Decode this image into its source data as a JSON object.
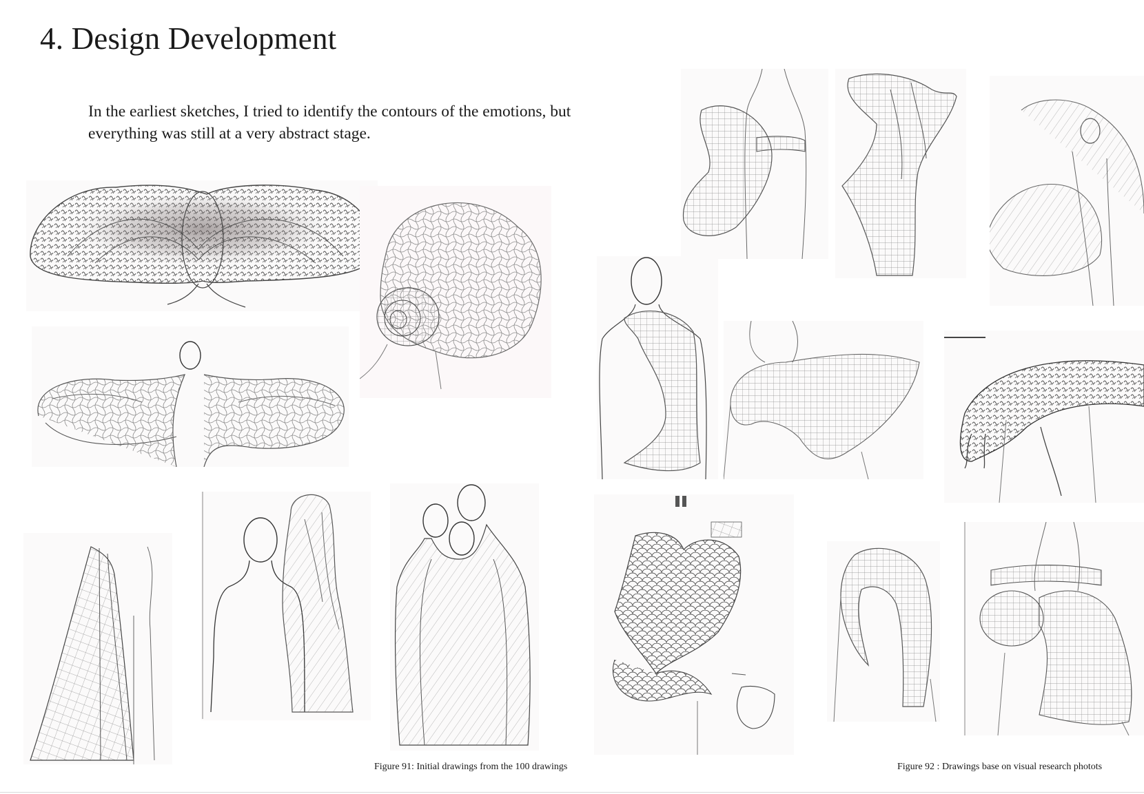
{
  "page": {
    "title": "4. Design Development",
    "intro": "In the earliest sketches, I tried to identify the contours of the emotions, but everything was still at a very abstract stage."
  },
  "figures": [
    {
      "caption": "Figure 91: Initial drawings from the 100 drawings",
      "sketches": [
        "butterfly-wing-sketch",
        "coiled-grid-sketch",
        "caped-figure-sketch",
        "flowing-skirt-sketch",
        "hooded-figure-sketch",
        "two-figures-sketch"
      ]
    },
    {
      "caption": "Figure 92 : Drawings base on visual research photots",
      "sketches": [
        "draped-torso-sketch",
        "twisted-column-sketch",
        "dancing-figure-sketch",
        "shoulder-wrap-sketch",
        "winged-shoulder-sketch",
        "textured-arm-sketch",
        "scaled-garment-sketch",
        "arched-form-sketch",
        "tubular-form-sketch"
      ]
    }
  ],
  "colors": {
    "ink": "#1a1a1a",
    "pencil": "#6e6e6e",
    "paper": "#fbfafa"
  }
}
